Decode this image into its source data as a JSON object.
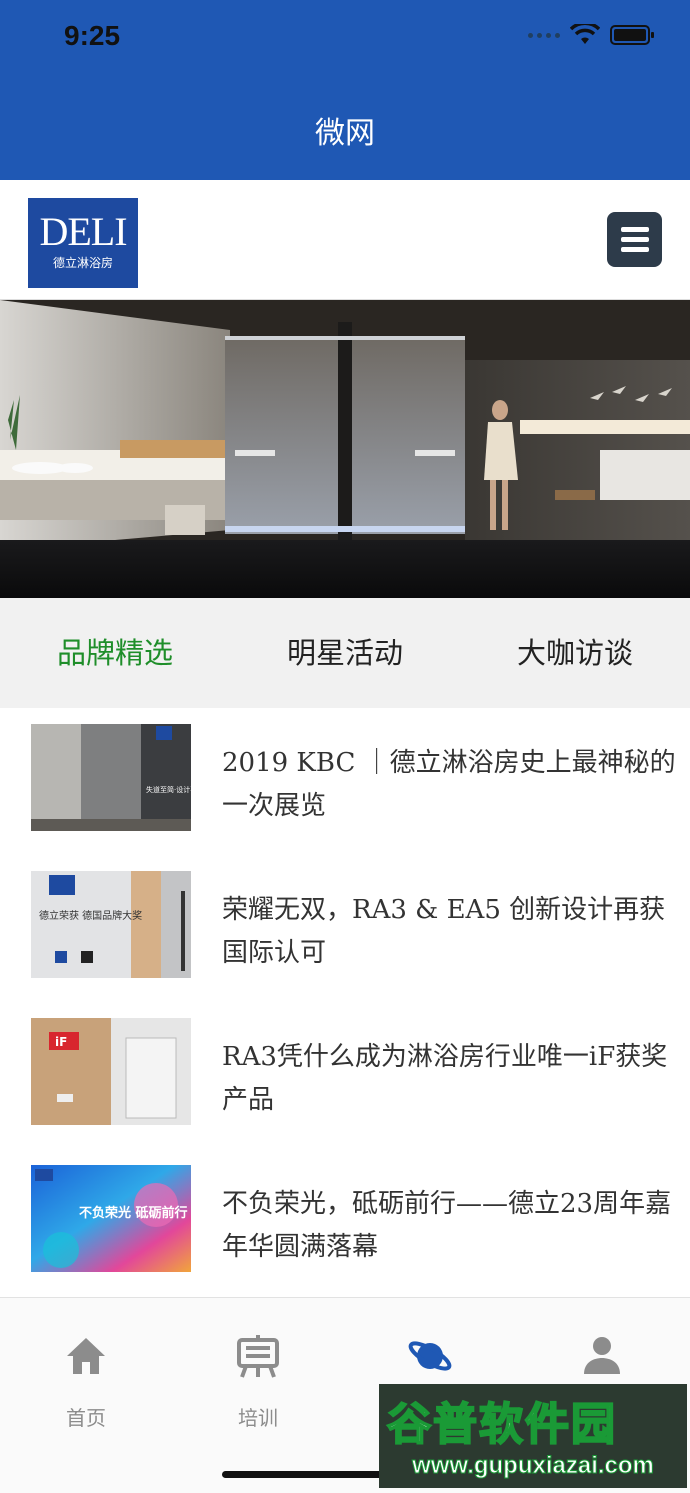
{
  "status_bar": {
    "time": "9:25"
  },
  "header": {
    "title": "微网"
  },
  "brand": {
    "logo_text": "DELI",
    "logo_sub": "德立淋浴房",
    "accent": "#1f58b4"
  },
  "tabs": [
    {
      "label": "品牌精选",
      "active": true
    },
    {
      "label": "明星活动",
      "active": false
    },
    {
      "label": "大咖访谈",
      "active": false
    }
  ],
  "articles": [
    {
      "title": "2019 KBC ｜德立淋浴房史上最神秘的一次展览",
      "thumb_text": "失道至简·设计不凡"
    },
    {
      "title": "荣耀无双，RA3 & EA5 创新设计再获国际认可",
      "thumb_text": "德立荣获 德国品牌大奖"
    },
    {
      "title": "RA3凭什么成为淋浴房行业唯一iF获奖产品",
      "thumb_text": "iF"
    },
    {
      "title": "不负荣光，砥砺前行——德立23周年嘉年华圆满落幕",
      "thumb_text": "不负荣光 砥砺前行"
    }
  ],
  "bottom_nav": [
    {
      "label": "首页",
      "icon": "home-icon"
    },
    {
      "label": "培训",
      "icon": "easel-icon"
    },
    {
      "label": "",
      "icon": "planet-icon"
    },
    {
      "label": "",
      "icon": "user-icon"
    }
  ],
  "watermark": {
    "main": "谷普软件园",
    "url": "www.gupuxiazai.com"
  },
  "colors": {
    "header_blue": "#1f58b4",
    "active_tab": "#1f8e2a",
    "nav_gray": "#8c8c8c",
    "nav_active": "#1f58b4"
  }
}
